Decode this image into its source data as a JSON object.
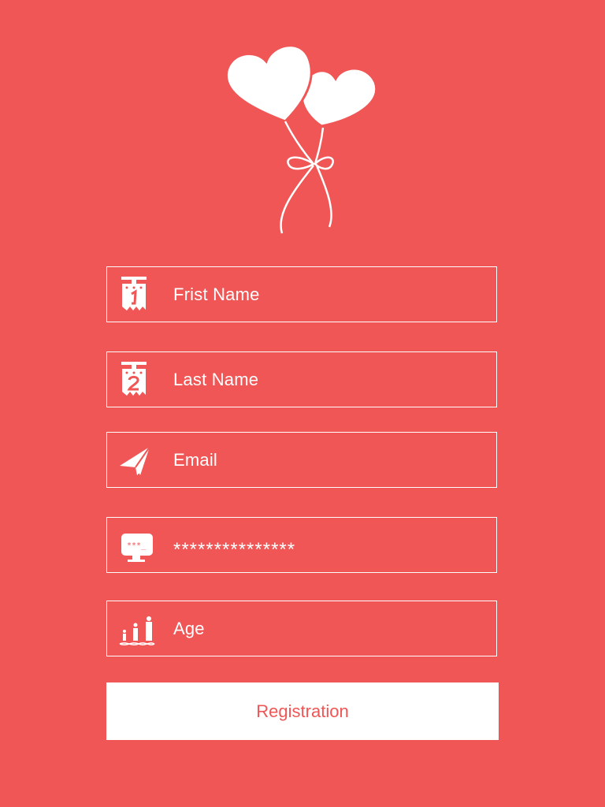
{
  "logo": {
    "icon": "heart-balloons-icon"
  },
  "form": {
    "first_name": {
      "placeholder": "Frist Name",
      "icon": "badge-1-icon"
    },
    "last_name": {
      "placeholder": "Last Name",
      "icon": "badge-2-icon"
    },
    "email": {
      "placeholder": "Email",
      "icon": "paper-plane-icon"
    },
    "password": {
      "value": "***************",
      "icon": "password-monitor-icon"
    },
    "age": {
      "placeholder": "Age",
      "icon": "people-growth-dna-icon"
    }
  },
  "submit": {
    "label": "Registration"
  },
  "colors": {
    "background": "#EF5655",
    "foreground": "#FFFFFF",
    "button_text": "#EF5655"
  }
}
